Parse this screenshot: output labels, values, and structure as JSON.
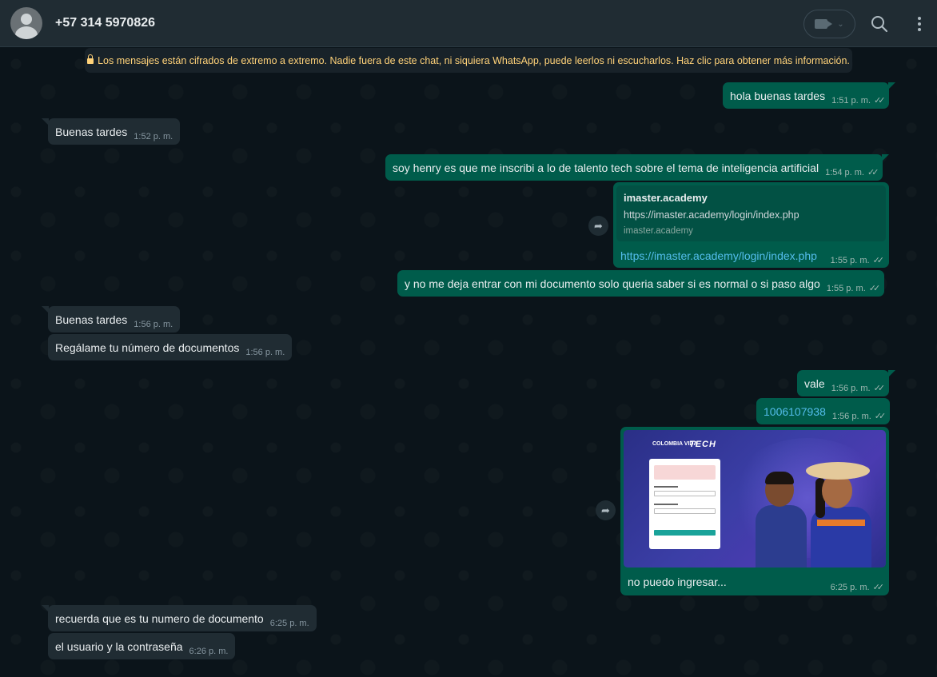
{
  "header": {
    "contact_name": "+57 314 5970826"
  },
  "encryption_notice": "Los mensajes están cifrados de extremo a extremo. Nadie fuera de este chat, ni siquiera WhatsApp, puede leerlos ni escucharlos. Haz clic para obtener más información.",
  "messages": [
    {
      "text": "hola buenas tardes",
      "time": "1:51 p. m.",
      "direction": "out"
    },
    {
      "text": "Buenas tardes",
      "time": "1:52 p. m.",
      "direction": "in"
    },
    {
      "text": "soy henry es que me inscribi a lo de talento tech sobre el tema de inteligencia artificial",
      "time": "1:54 p. m.",
      "direction": "out"
    },
    {
      "text": "y no me deja entrar con mi documento solo queria saber si es normal o si paso algo",
      "time": "1:55 p. m.",
      "direction": "out"
    },
    {
      "text": "Buenas tardes",
      "time": "1:56 p. m.",
      "direction": "in"
    },
    {
      "text": "Regálame tu número de documentos",
      "time": "1:56 p. m.",
      "direction": "in"
    },
    {
      "text": "vale",
      "time": "1:56 p. m.",
      "direction": "out"
    },
    {
      "text": "1006107938",
      "time": "1:56 p. m.",
      "direction": "out"
    },
    {
      "text": "recuerda que es tu numero de documento",
      "time": "6:25 p. m.",
      "direction": "in"
    },
    {
      "text": "el usuario y la contraseña",
      "time": "6:26 p. m.",
      "direction": "in"
    }
  ],
  "link_preview": {
    "title": "imaster.academy",
    "url": "https://imaster.academy/login/index.php",
    "domain": "imaster.academy",
    "link_text": "https://imaster.academy/login/index.php",
    "time": "1:55 p. m."
  },
  "image_message": {
    "caption": "no puedo ingresar...",
    "time": "6:25 p. m.",
    "logo_text_left": "COLOMBIA VIDA",
    "logo_text_right": "TECH"
  },
  "icons": {
    "ticks": "✓✓",
    "forward": "➦"
  },
  "colors": {
    "outgoing_bubble": "#005c4b",
    "incoming_bubble": "#202c33",
    "background": "#0b141a",
    "link": "#53bdeb",
    "notice_text": "#ffd279"
  }
}
